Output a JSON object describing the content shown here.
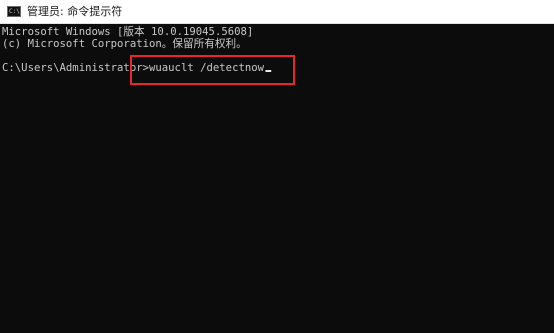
{
  "window": {
    "title": "管理员: 命令提示符",
    "icon_name": "command-prompt-icon",
    "icon_glyph": "C:\\"
  },
  "console": {
    "line1": "Microsoft Windows [版本 10.0.19045.5608]",
    "line2": "(c) Microsoft Corporation。保留所有权利。",
    "prompt": "C:\\Users\\Administrator>",
    "command": "wuauclt /detectnow"
  },
  "colors": {
    "console_background": "#0c0c0c",
    "console_text": "#c8c8c8",
    "highlight": "#e8262d"
  }
}
